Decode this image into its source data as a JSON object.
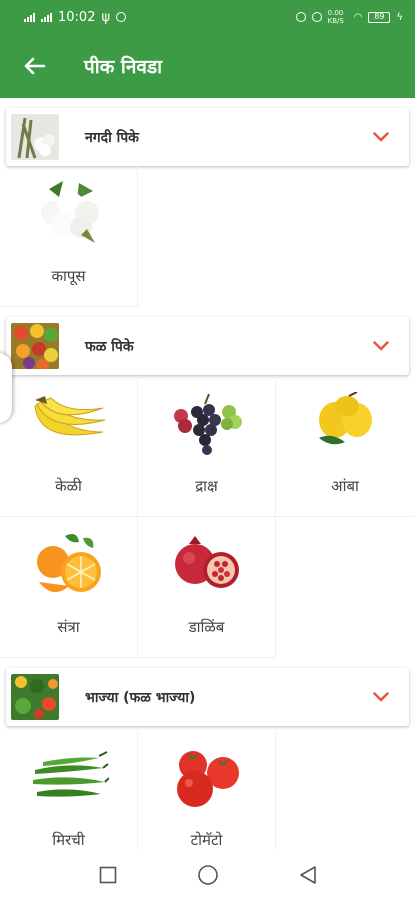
{
  "status_bar": {
    "time": "10:02",
    "network_speed": "0.00 KB/S",
    "battery": "89"
  },
  "app_bar": {
    "title": "पीक निवडा",
    "back_icon": "arrow-left-icon"
  },
  "sections": [
    {
      "title": "नगदी पिके",
      "thumbnail": "cotton-crop-thumbnail",
      "items": [
        {
          "label": "कापूस",
          "icon": "cotton-icon"
        }
      ]
    },
    {
      "title": "फळ पिके",
      "thumbnail": "fruit-basket-thumbnail",
      "items": [
        {
          "label": "केळी",
          "icon": "banana-icon"
        },
        {
          "label": "द्राक्ष",
          "icon": "grapes-icon"
        },
        {
          "label": "आंबा",
          "icon": "mango-icon"
        },
        {
          "label": "संत्रा",
          "icon": "orange-icon"
        },
        {
          "label": "डाळिंब",
          "icon": "pomegranate-icon"
        }
      ]
    },
    {
      "title": "भाज्या (फळ भाज्या)",
      "thumbnail": "vegetables-thumbnail",
      "items": [
        {
          "label": "मिरची",
          "icon": "chilli-icon"
        },
        {
          "label": "टोमॅटो",
          "icon": "tomato-icon"
        }
      ]
    }
  ],
  "colors": {
    "primary": "#3e9b45",
    "chevron": "#e8553a"
  },
  "nav_bar": {
    "icons": [
      "recents-square-icon",
      "home-circle-icon",
      "back-triangle-icon"
    ]
  }
}
